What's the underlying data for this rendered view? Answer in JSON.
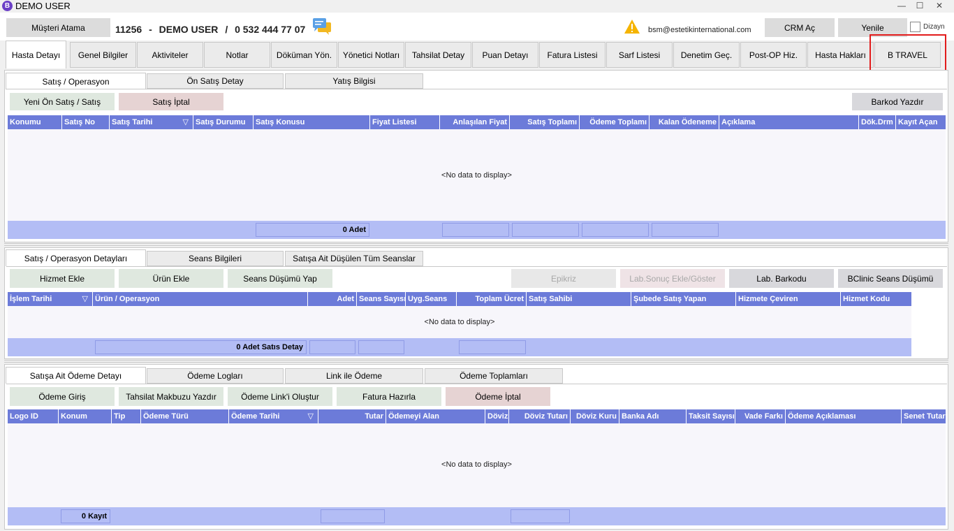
{
  "window": {
    "title": "DEMO USER",
    "logo_letter": "B",
    "min": "—",
    "max": "☐",
    "close": "✕"
  },
  "header": {
    "assign_button": "Müşteri Atama",
    "patient_id": "11256",
    "sep1": "-",
    "patient_name": "DEMO USER",
    "sep2": "/",
    "phone": "0 532 444 77 07",
    "email": "bsm@estetikinternational.com",
    "crm_button": "CRM Aç",
    "refresh_button": "Yenile",
    "design_label": "Dizayn"
  },
  "main_tabs": [
    "Hasta Detayı",
    "Genel Bilgiler",
    "Aktiviteler",
    "Notlar",
    "Döküman Yön.",
    "Yönetici Notları",
    "Tahsilat Detay",
    "Puan Detayı",
    "Fatura Listesi",
    "Sarf Listesi",
    "Denetim Geç.",
    "Post-OP Hiz.",
    "Hasta Hakları",
    "B TRAVEL"
  ],
  "sales": {
    "tabs": [
      "Satış / Operasyon",
      "Ön Satış Detay",
      "Yatış Bilgisi"
    ],
    "buttons": {
      "new_sale": "Yeni Ön Satış / Satış",
      "cancel_sale": "Satış İptal",
      "print_barcode": "Barkod Yazdır"
    },
    "columns": [
      "Konumu",
      "Satış No",
      "Satış Tarihi",
      "Satış Durumu",
      "Satış Konusu",
      "Fiyat Listesi",
      "Anlaşılan Fiyat",
      "Satış Toplamı",
      "Ödeme Toplamı",
      "Kalan Ödeneme",
      "Açıklama",
      "Dök.Drm",
      "Kayıt Açan"
    ],
    "empty": "<No data to display>",
    "footer_count": "0 Adet"
  },
  "details": {
    "tabs": [
      "Satış / Operasyon Detayları",
      "Seans Bilgileri",
      "Satışa Ait Düşülen Tüm Seanslar"
    ],
    "buttons": [
      "Hizmet Ekle",
      "Ürün Ekle",
      "Seans Düşümü Yap",
      "Epikriz",
      "Lab.Sonuç Ekle/Göster",
      "Lab. Barkodu",
      "BClinic Seans Düşümü"
    ],
    "columns": [
      "İşlem Tarihi",
      "Ürün / Operasyon",
      "Adet",
      "Seans Sayısı",
      "Uyg.Seans",
      "Toplam Ücret",
      "Satış Sahibi",
      "Şubede Satış Yapan",
      "Hizmete Çeviren",
      "Hizmet Kodu"
    ],
    "empty": "<No data to display>",
    "footer_count": "0 Adet Satıs Detay"
  },
  "payments": {
    "tabs": [
      "Satışa Ait Ödeme Detayı",
      "Ödeme Logları",
      "Link ile Ödeme",
      "Ödeme Toplamları"
    ],
    "buttons": [
      "Ödeme Giriş",
      "Tahsilat Makbuzu Yazdır",
      "Ödeme Link'i Oluştur",
      "Fatura Hazırla",
      "Ödeme İptal"
    ],
    "columns": [
      "Logo ID",
      "Konum",
      "Tip",
      "Ödeme Türü",
      "Ödeme Tarihi",
      "Tutar",
      "Ödemeyi Alan",
      "Döviz",
      "Döviz Tutarı",
      "Döviz Kuru",
      "Banka Adı",
      "Taksit Sayısı",
      "Vade Farkı",
      "Ödeme Açıklaması",
      "Senet Tutar"
    ],
    "empty": "<No data to display>",
    "footer_count": "0 Kayıt"
  },
  "icons": {
    "chat": "chat-bubble-icon",
    "warning": "warning-icon",
    "sort": "▽"
  },
  "colors": {
    "grid_header": "#6c7bd9",
    "grid_footer": "#b3bdf5",
    "highlight": "#e21c1c",
    "brand": "#6a3fc6"
  }
}
